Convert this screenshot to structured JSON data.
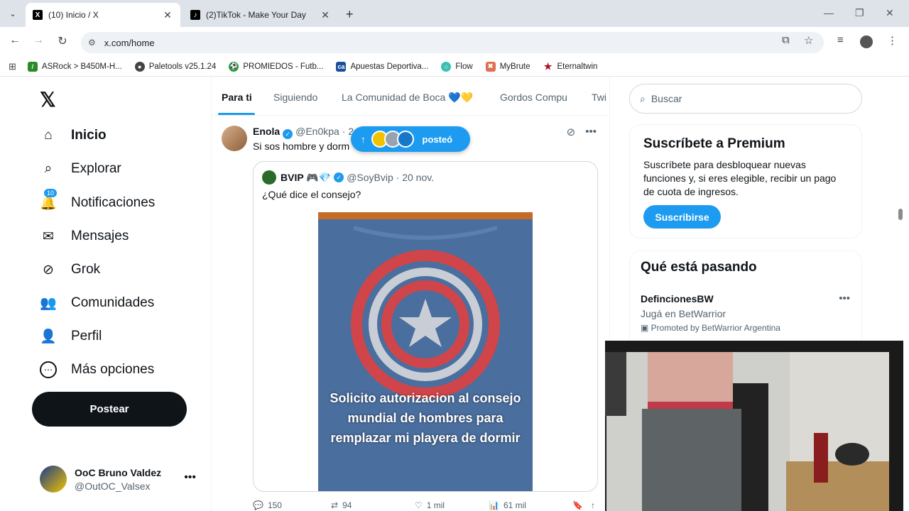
{
  "browser": {
    "tabs": [
      {
        "label": "(10) Inicio / X",
        "favicon": "X"
      },
      {
        "label": "(2)TikTok - Make Your Day",
        "favicon": "♪"
      }
    ],
    "url": "x.com/home",
    "bookmarks": [
      {
        "label": "ASRock > B450M-H...",
        "color": "#2a8a2a",
        "icon": "/"
      },
      {
        "label": "Paletools v25.1.24",
        "color": "#444444",
        "icon": "●"
      },
      {
        "label": "PROMIEDOS - Futb...",
        "color": "#22a33a",
        "icon": "⚽"
      },
      {
        "label": "Apuestas Deportiva...",
        "color": "#1b4f9c",
        "icon": "ca"
      },
      {
        "label": "Flow",
        "color": "#3ac0b0",
        "icon": "○"
      },
      {
        "label": "MyBrute",
        "color": "#e07050",
        "icon": "✖"
      },
      {
        "label": "Eternaltwin",
        "color": "#b01020",
        "icon": "★"
      }
    ]
  },
  "nav": {
    "logo": "𝕏",
    "items": [
      {
        "label": "Inicio",
        "icon": "⌂"
      },
      {
        "label": "Explorar",
        "icon": "⌕"
      },
      {
        "label": "Notificaciones",
        "icon": "🔔",
        "badge": "10"
      },
      {
        "label": "Mensajes",
        "icon": "✉"
      },
      {
        "label": "Grok",
        "icon": "⊘"
      },
      {
        "label": "Comunidades",
        "icon": "👥"
      },
      {
        "label": "Perfil",
        "icon": "👤"
      },
      {
        "label": "Más opciones",
        "icon": "⋯"
      }
    ],
    "post_label": "Postear",
    "account": {
      "name": "OoC Bruno Valdez",
      "handle": "@OutOC_Valsex"
    }
  },
  "feed": {
    "tabs": [
      "Para ti",
      "Siguiendo",
      "La Comunidad de Boca 💙💛",
      "Gordos Compu",
      "Twi"
    ],
    "tweet": {
      "name": "Enola",
      "handle": "@En0kpa · 2",
      "text": "Si sos hombre y dorm",
      "posted_pill": "posteó",
      "quote": {
        "name": "BVIP 🎮💎",
        "handle": "@SoyBvip · 20 nov.",
        "text": "¿Qué dice el consejo?",
        "image_caption": "Solicito autorizacion al consejo mundial de hombres para remplazar mi playera de dormir"
      },
      "actions": {
        "replies": "150",
        "reposts": "94",
        "likes": "1 mil",
        "views": "61 mil"
      }
    }
  },
  "sidebar": {
    "search_placeholder": "Buscar",
    "premium": {
      "title": "Suscríbete a Premium",
      "text": "Suscríbete para desbloquear nuevas funciones y, si eres elegible, recibir un pago de cuota de ingresos.",
      "button": "Suscribirse"
    },
    "trends": {
      "title": "Qué está pasando",
      "item": {
        "name": "DefincionesBW",
        "subtitle": "Jugá en BetWarrior",
        "promo": "Promoted by BetWarrior Argentina"
      }
    }
  }
}
